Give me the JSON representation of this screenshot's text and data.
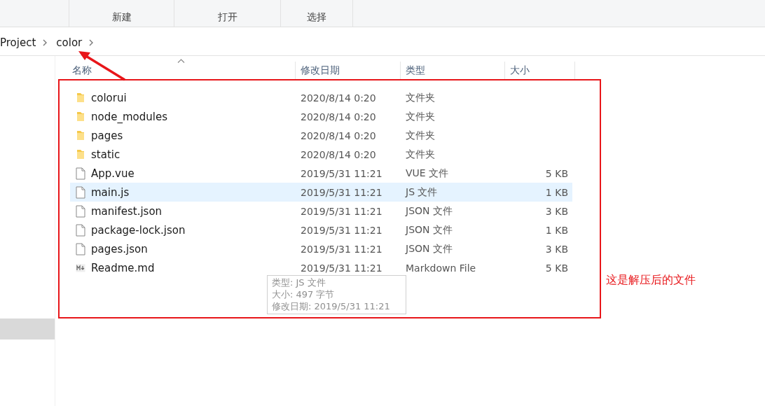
{
  "ribbon": {
    "groups": [
      "新建",
      "打开",
      "选择"
    ]
  },
  "address_bar": {
    "path": [
      "Project",
      "color"
    ]
  },
  "sidebar": {
    "items": [
      {
        "selected": true
      }
    ]
  },
  "table": {
    "columns": [
      "名称",
      "修改日期",
      "类型",
      "大小"
    ],
    "rows": [
      {
        "kind": "folder",
        "name": "colorui",
        "date": "2020/8/14 0:20",
        "type": "文件夹",
        "selected": false
      },
      {
        "kind": "folder",
        "name": "node_modules",
        "date": "2020/8/14 0:20",
        "type": "文件夹",
        "selected": false
      },
      {
        "kind": "folder",
        "name": "pages",
        "date": "2020/8/14 0:20",
        "type": "文件夹",
        "selected": false
      },
      {
        "kind": "folder",
        "name": "static",
        "date": "2020/8/14 0:20",
        "type": "文件夹",
        "selected": false
      },
      {
        "kind": "file",
        "name": "App.vue",
        "date": "2019/5/31 11:21",
        "type": "VUE 文件",
        "size": "5 KB",
        "selected": false
      },
      {
        "kind": "file",
        "name": "main.js",
        "date": "2019/5/31 11:21",
        "type": "JS 文件",
        "size": "1 KB",
        "selected": true
      },
      {
        "kind": "file",
        "name": "manifest.json",
        "date": "2019/5/31 11:21",
        "type": "JSON 文件",
        "size": "3 KB",
        "selected": false
      },
      {
        "kind": "file",
        "name": "package-lock.json",
        "date": "2019/5/31 11:21",
        "type": "JSON 文件",
        "size": "1 KB",
        "selected": false
      },
      {
        "kind": "file",
        "name": "pages.json",
        "date": "2019/5/31 11:21",
        "type": "JSON 文件",
        "size": "3 KB",
        "selected": false
      },
      {
        "kind": "markdown",
        "name": "Readme.md",
        "date": "2019/5/31 11:21",
        "type": "Markdown File",
        "size": "5 KB",
        "selected": false
      }
    ]
  },
  "tooltip": {
    "lines": [
      "类型: JS 文件",
      "大小: 497 字节",
      "修改日期: 2019/5/31 11:21"
    ]
  },
  "annotation": {
    "text": "这是解压后的文件"
  }
}
